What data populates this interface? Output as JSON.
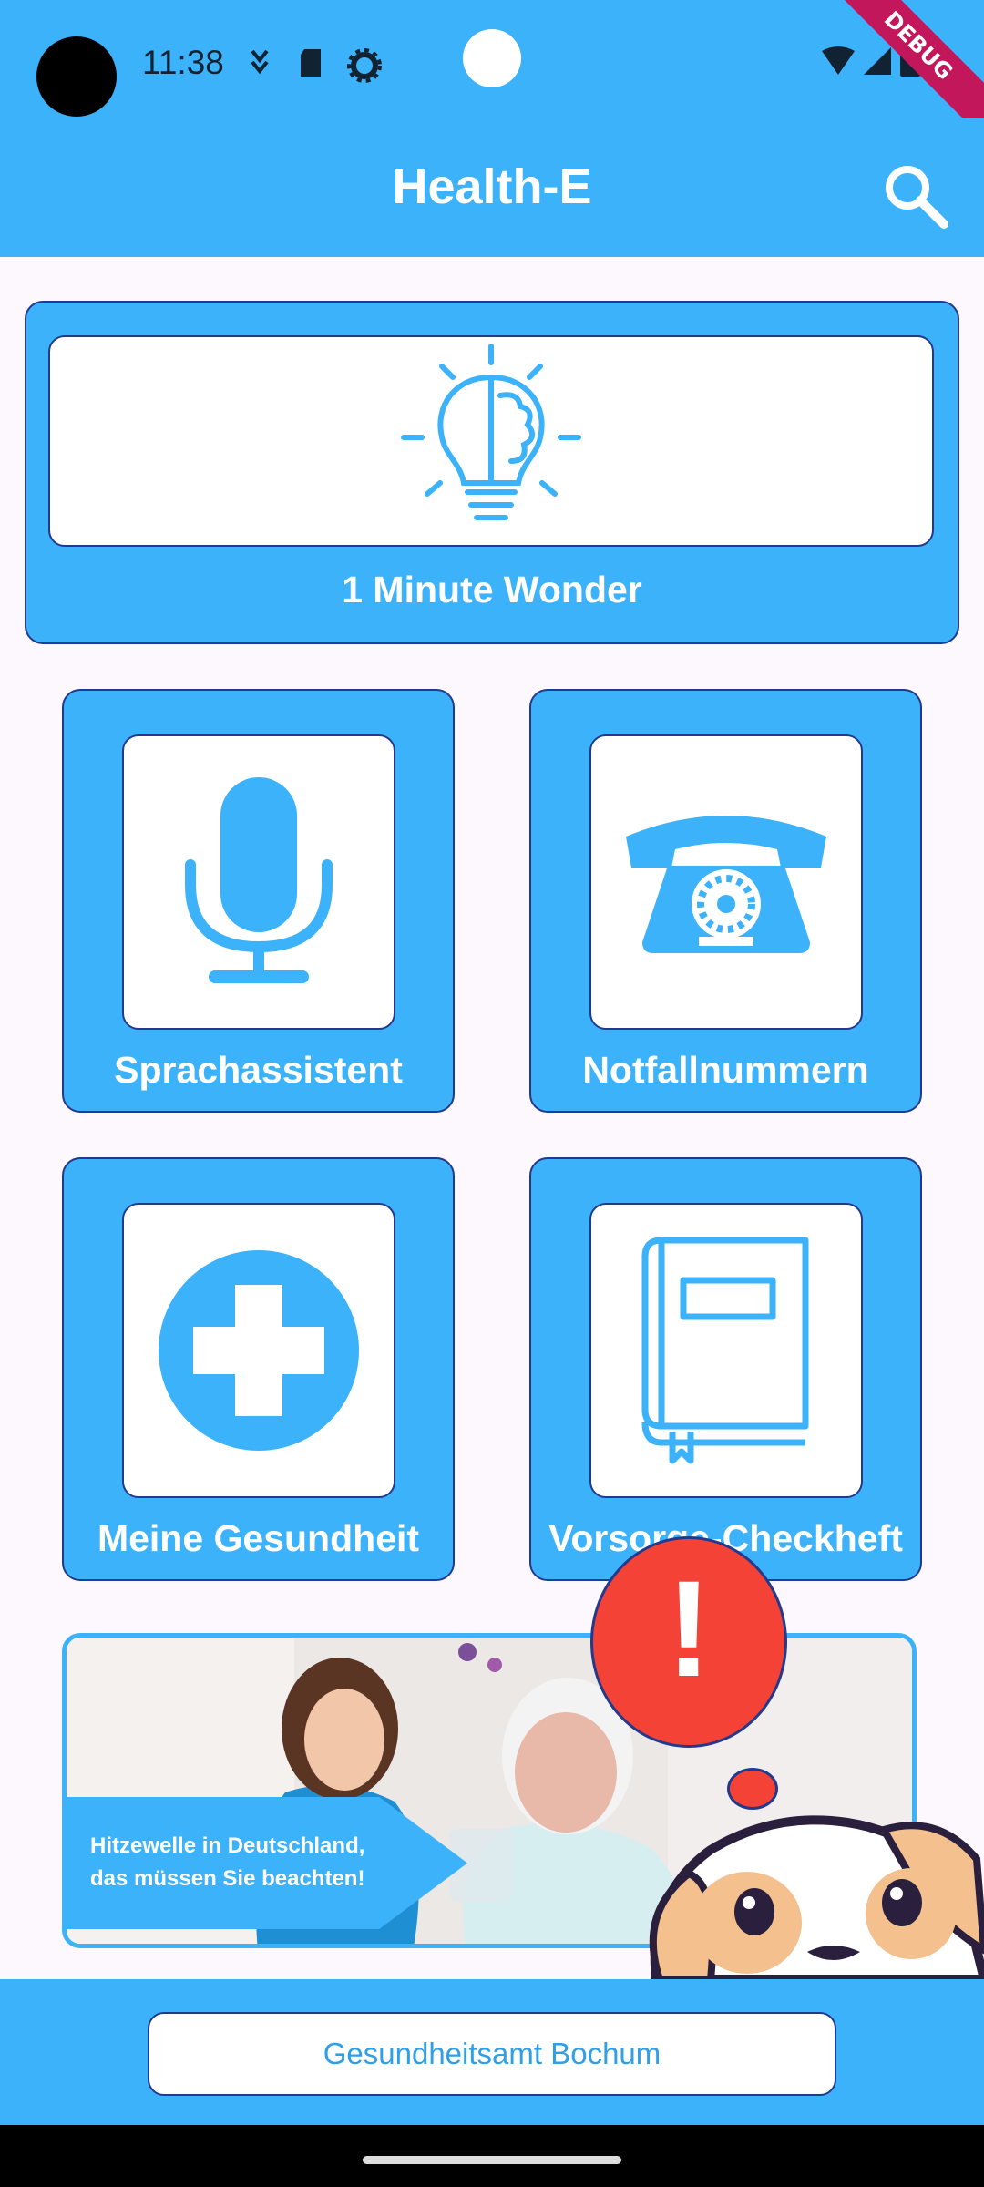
{
  "status_bar": {
    "time": "11:38",
    "debug_banner": "DEBUG",
    "icons": [
      "location-pin-icon",
      "sd-card-icon",
      "settings-gear-icon",
      "wifi-icon",
      "signal-icon",
      "battery-icon"
    ]
  },
  "app_bar": {
    "title": "Health-E",
    "action_icon": "search-icon"
  },
  "feature": {
    "label": "1 Minute Wonder",
    "icon": "lightbulb-brain-icon"
  },
  "tiles": [
    {
      "label": "Sprachassistent",
      "icon": "microphone-icon"
    },
    {
      "label": "Notfallnummern",
      "icon": "telephone-icon"
    },
    {
      "label": "Meine Gesundheit",
      "icon": "medical-cross-icon"
    },
    {
      "label": "Vorsorge-Checkheft",
      "icon": "book-icon"
    }
  ],
  "banner": {
    "text_line1": "Hitzewelle in Deutschland,",
    "text_line2": "das müssen Sie beachten!"
  },
  "alert": {
    "symbol": "!"
  },
  "bottom": {
    "button_label": "Gesundheitsamt Bochum"
  },
  "colors": {
    "primary": "#3cb2fb",
    "border": "#233a8c",
    "alert": "#f44336",
    "background": "#fdf8fd"
  }
}
